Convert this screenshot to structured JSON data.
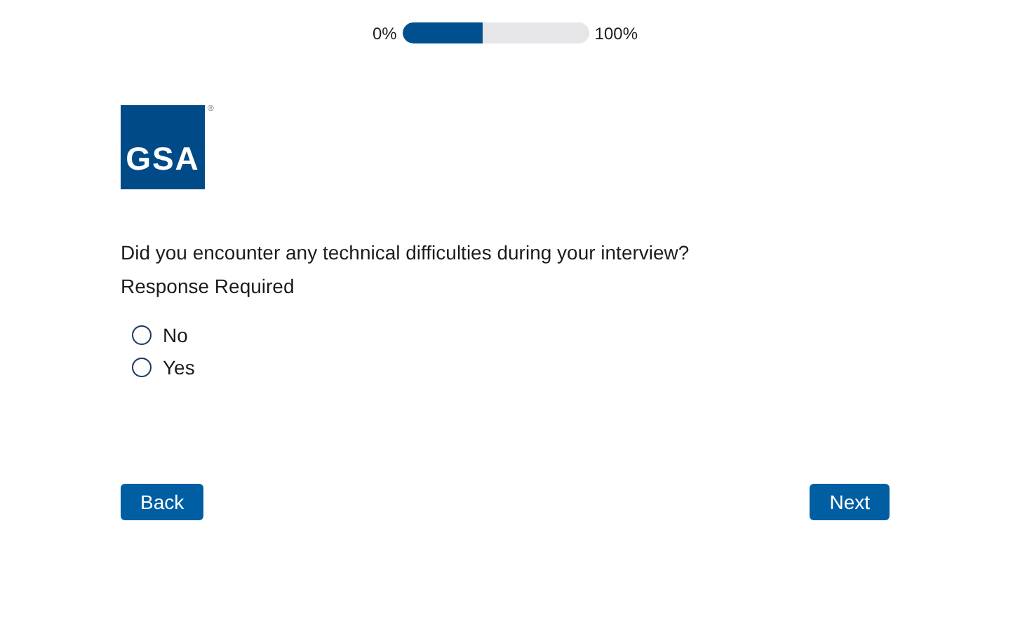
{
  "progress": {
    "start_label": "0%",
    "end_label": "100%",
    "level": 0.43
  },
  "logo": {
    "text": "GSA",
    "mark": "®"
  },
  "question": {
    "text": "Did you encounter any technical difficulties during your interview?",
    "note": "Response Required"
  },
  "options": [
    {
      "label": "No",
      "selected": false
    },
    {
      "label": "Yes",
      "selected": false
    }
  ],
  "buttons": {
    "back": "Back",
    "next": "Next"
  }
}
